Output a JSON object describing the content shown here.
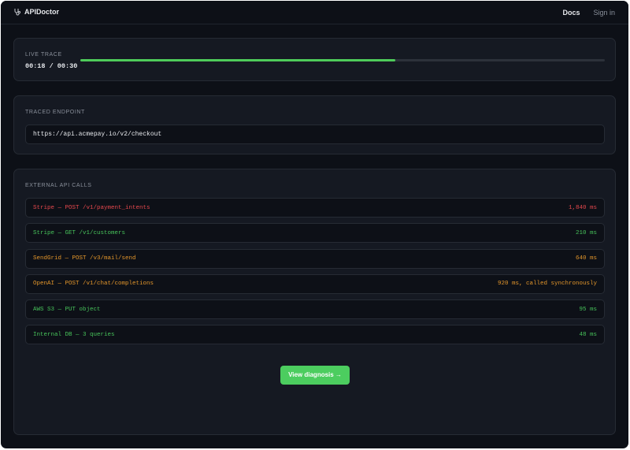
{
  "app": {
    "name": "APIDoctor",
    "nav": {
      "docs": "Docs",
      "sign_in": "Sign in"
    }
  },
  "trace": {
    "label": "LIVE TRACE",
    "timer": "00:18 / 00:30",
    "progress": 0.6,
    "accent": "#4ecb5a"
  },
  "endpoint": {
    "label": "TRACED ENDPOINT",
    "value": "https://api.acmepay.io/v2/checkout"
  },
  "calls": {
    "label": "EXTERNAL API CALLS",
    "rows": [
      {
        "name": "Stripe — POST /v1/payment_intents",
        "timing": "1,840 ms",
        "status": "red"
      },
      {
        "name": "Stripe — GET /v1/customers",
        "timing": "210 ms",
        "status": "green"
      },
      {
        "name": "SendGrid — POST /v3/mail/send",
        "timing": "640 ms",
        "status": "amber"
      },
      {
        "name": "OpenAI — POST /v1/chat/completions",
        "timing": "920 ms, called synchronously",
        "status": "amber"
      },
      {
        "name": "AWS S3 — PUT object",
        "timing": "95 ms",
        "status": "green"
      },
      {
        "name": "Internal DB — 3 queries",
        "timing": "48 ms",
        "status": "green"
      }
    ],
    "status_colors": {
      "red": "#e5484d",
      "green": "#47c25a",
      "amber": "#e3962b"
    }
  },
  "actions": {
    "diagnosis": "View diagnosis →",
    "button_color": "#4ccd5f"
  }
}
